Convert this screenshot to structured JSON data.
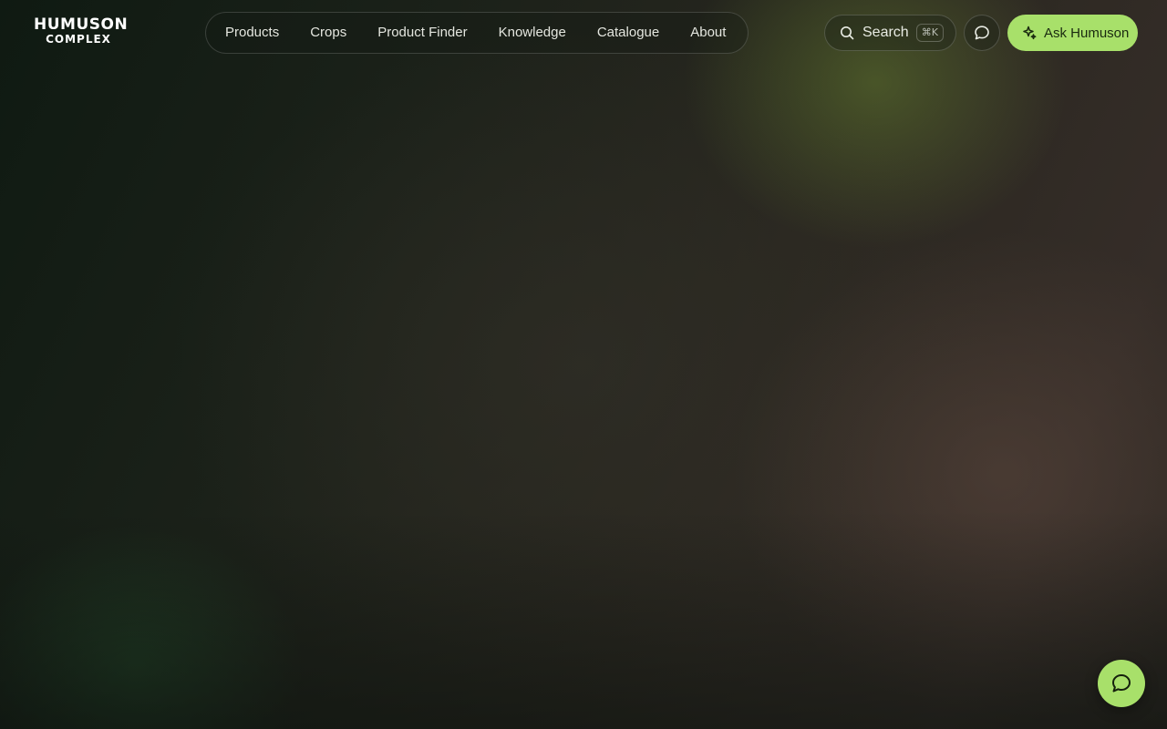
{
  "brand": {
    "logo_top": "HUMUSON",
    "logo_bottom": "COMPLEX"
  },
  "nav": {
    "items": [
      {
        "label": "Products"
      },
      {
        "label": "Crops"
      },
      {
        "label": "Product Finder"
      },
      {
        "label": "Knowledge"
      },
      {
        "label": "Catalogue"
      },
      {
        "label": "About"
      }
    ]
  },
  "search": {
    "label": "Search",
    "shortcut": "⌘K",
    "icon": "search-icon"
  },
  "chat": {
    "icon": "chat-bubble-icon"
  },
  "ask": {
    "label": "Ask Humuson",
    "icon": "sparkle-icon"
  },
  "fab": {
    "icon": "chat-bubble-icon"
  },
  "colors": {
    "accent": "#a8e06a",
    "text": "#e8ebe3"
  }
}
